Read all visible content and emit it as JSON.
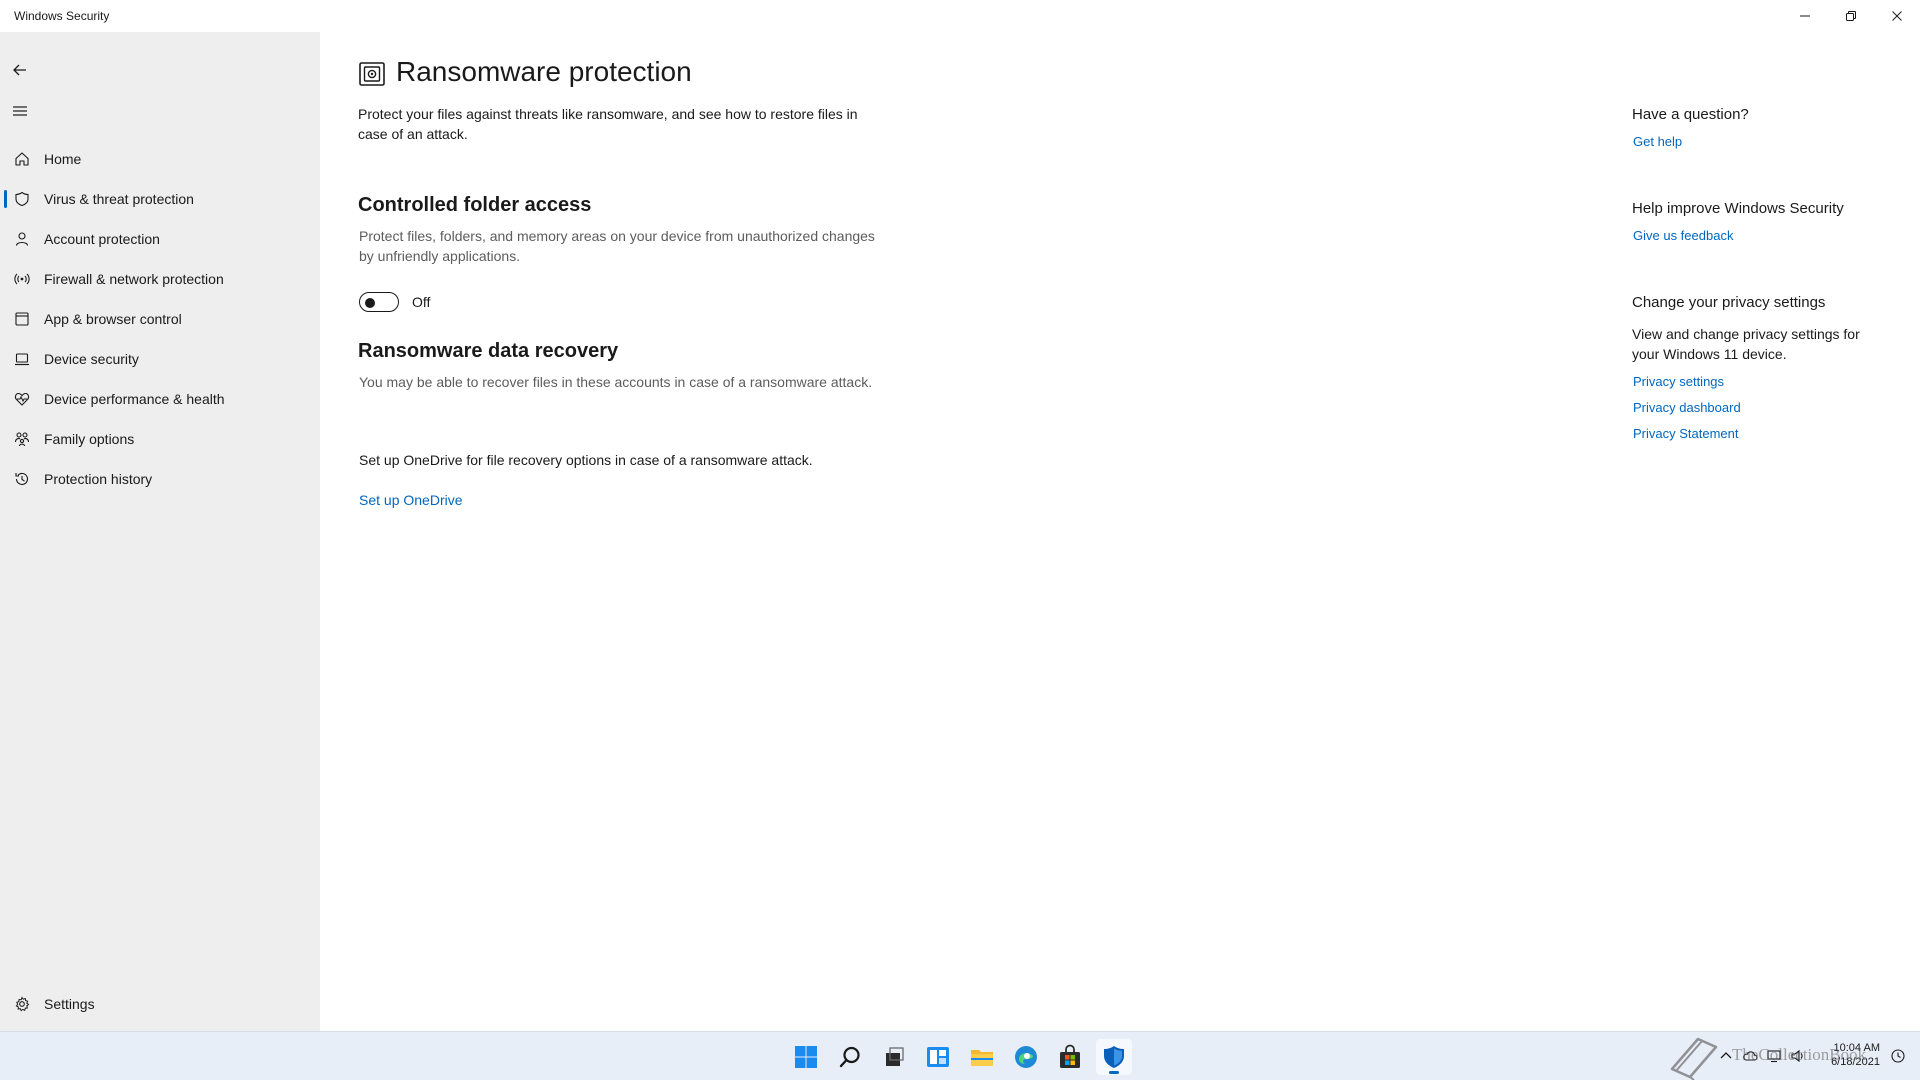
{
  "window": {
    "title": "Windows Security",
    "controls": [
      "minimize-icon",
      "restore-icon",
      "close-icon"
    ]
  },
  "sidebar": {
    "back_icon": "back-arrow-icon",
    "menu_icon": "hamburger-icon",
    "items": [
      {
        "label": "Home",
        "icon": "home-icon"
      },
      {
        "label": "Virus & threat protection",
        "icon": "shield-icon",
        "active": true
      },
      {
        "label": "Account protection",
        "icon": "person-icon"
      },
      {
        "label": "Firewall & network protection",
        "icon": "wireless-icon"
      },
      {
        "label": "App & browser control",
        "icon": "app-window-icon"
      },
      {
        "label": "Device security",
        "icon": "laptop-icon"
      },
      {
        "label": "Device performance & health",
        "icon": "heart-pulse-icon"
      },
      {
        "label": "Family options",
        "icon": "family-icon"
      },
      {
        "label": "Protection history",
        "icon": "history-icon"
      }
    ],
    "settings": {
      "label": "Settings",
      "icon": "gear-icon"
    }
  },
  "main": {
    "title": "Ransomware protection",
    "title_icon": "ransomware-vault-icon",
    "description": "Protect your files against threats like ransomware, and see how to restore files in case of an attack.",
    "cfa": {
      "title": "Controlled folder access",
      "description": "Protect files, folders, and memory areas on your device from unauthorized changes by unfriendly applications.",
      "toggle_state": "Off"
    },
    "recovery": {
      "title": "Ransomware data recovery",
      "description": "You may be able to recover files in these accounts in case of a ransomware attack.",
      "setup_text": "Set up OneDrive for file recovery options in case of a ransomware attack.",
      "setup_link": "Set up OneDrive"
    }
  },
  "right_panel": {
    "question": {
      "heading": "Have a question?",
      "link": "Get help"
    },
    "improve": {
      "heading": "Help improve Windows Security",
      "link": "Give us feedback"
    },
    "privacy": {
      "heading": "Change your privacy settings",
      "text": "View and change privacy settings for your Windows 11 device.",
      "links": [
        "Privacy settings",
        "Privacy dashboard",
        "Privacy Statement"
      ]
    }
  },
  "taskbar": {
    "apps": [
      "start-icon",
      "search-icon",
      "task-view-icon",
      "widgets-icon",
      "file-explorer-icon",
      "edge-icon",
      "store-icon",
      "windows-security-icon"
    ],
    "active_app": "windows-security-icon",
    "tray": [
      "chevron-up-icon",
      "cloud-icon",
      "monitor-icon",
      "speaker-icon"
    ],
    "time": "10:04 AM",
    "date": "6/18/2021",
    "watermark": "TheCollectionBook"
  },
  "colors": {
    "accent": "#0067c0",
    "sidebar_bg": "#eeeeee",
    "taskbar_bg": "#e8eef7"
  }
}
